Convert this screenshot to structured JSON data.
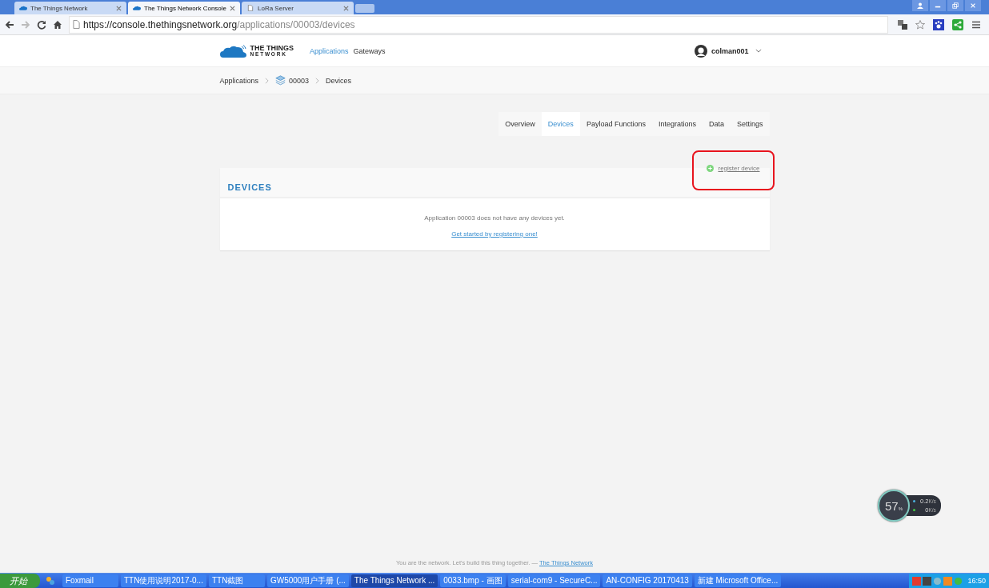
{
  "browser": {
    "tabs": [
      {
        "title": "The Things Network",
        "selected": false,
        "kind": "site"
      },
      {
        "title": "The Things Network Console",
        "selected": true,
        "kind": "site"
      },
      {
        "title": "LoRa Server",
        "selected": false,
        "kind": "document"
      }
    ],
    "url_host": "https://console.thethingsnetwork.org",
    "url_path": "/applications/00003/devices"
  },
  "header": {
    "logo_top": "THE THINGS",
    "logo_bottom": "N E T W O R K",
    "nav": [
      {
        "label": "Applications",
        "selected": true
      },
      {
        "label": "Gateways",
        "selected": false
      }
    ],
    "user": "colman001"
  },
  "breadcrumb": [
    {
      "label": "Applications",
      "icon": false
    },
    {
      "label": "00003",
      "icon": true
    },
    {
      "label": "Devices",
      "icon": false
    }
  ],
  "tabs": [
    {
      "label": "Overview",
      "selected": false
    },
    {
      "label": "Devices",
      "selected": true
    },
    {
      "label": "Payload Functions",
      "selected": false
    },
    {
      "label": "Integrations",
      "selected": false
    },
    {
      "label": "Data",
      "selected": false
    },
    {
      "label": "Settings",
      "selected": false
    }
  ],
  "devices": {
    "title": "DEVICES",
    "register": "register device",
    "empty_text": "Application 00003 does not have any devices yet.",
    "empty_link": "Get started by registering one!"
  },
  "footer": {
    "text": "You are the network. Let's build this thing together. — ",
    "link": "The Things Network"
  },
  "meter": {
    "value": "57",
    "unit": "%",
    "up": "0.2",
    "up_unit": "K/s",
    "down": "0",
    "down_unit": "K/s"
  },
  "taskbar": {
    "start": "开始",
    "items": [
      {
        "label": "Foxmail",
        "selected": false
      },
      {
        "label": "TTN使用说明2017-0...",
        "selected": false
      },
      {
        "label": "TTN截图",
        "selected": false
      },
      {
        "label": "GW5000用户手册 (...",
        "selected": false
      },
      {
        "label": "The Things Network ...",
        "selected": true
      },
      {
        "label": "0033.bmp - 画图",
        "selected": false
      },
      {
        "label": "serial-com9 - SecureC...",
        "selected": false
      },
      {
        "label": "AN-CONFIG 20170413",
        "selected": false
      },
      {
        "label": "新建 Microsoft Office...",
        "selected": false
      }
    ],
    "clock": "16:50"
  }
}
